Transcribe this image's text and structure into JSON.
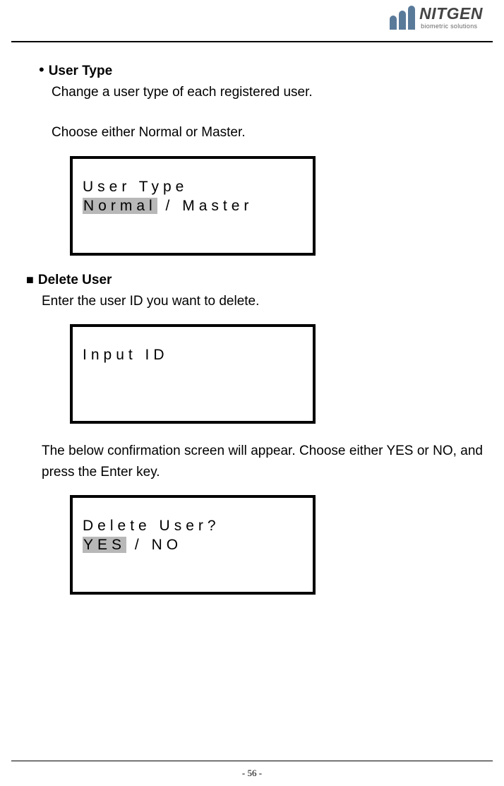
{
  "header": {
    "logo_name": "NITGEN",
    "logo_sub": "biometric solutions"
  },
  "sections": {
    "user_type": {
      "title": "User Type",
      "desc1": "Change a user type of each registered user.",
      "desc2": "Choose either Normal or Master.",
      "screen_line1": "User Type",
      "screen_hl": "Normal",
      "screen_sep": "/",
      "screen_opt2": "Master"
    },
    "delete_user": {
      "title": "Delete User",
      "desc1": "Enter the user ID you want to delete.",
      "screen1_line1": "Input ID",
      "desc2": "The below confirmation screen will appear. Choose either YES or NO, and press the Enter key.",
      "screen2_line1": "Delete User?",
      "screen2_hl": "YES",
      "screen2_sep": "/",
      "screen2_opt2": "NO"
    }
  },
  "footer": {
    "page": "- 56 -"
  }
}
